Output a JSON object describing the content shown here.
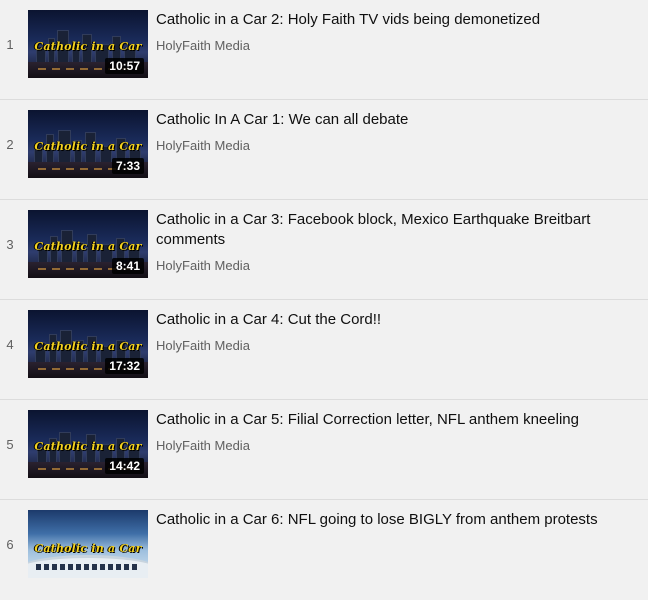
{
  "playlist": {
    "items": [
      {
        "index": "1",
        "title": "Catholic in a Car 2: Holy Faith TV vids being demonetized",
        "channel": "HolyFaith Media",
        "duration": "10:57",
        "thumb_text": "Catholic in a Car"
      },
      {
        "index": "2",
        "title": "Catholic In A Car 1: We can all debate",
        "channel": "HolyFaith Media",
        "duration": "7:33",
        "thumb_text": "Catholic in a Car"
      },
      {
        "index": "3",
        "title": "Catholic in a Car 3: Facebook block, Mexico Earthquake Breitbart comments",
        "channel": "HolyFaith Media",
        "duration": "8:41",
        "thumb_text": "Catholic in a Car"
      },
      {
        "index": "4",
        "title": "Catholic in a Car 4: Cut the Cord!!",
        "channel": "HolyFaith Media",
        "duration": "17:32",
        "thumb_text": "Catholic in a Car"
      },
      {
        "index": "5",
        "title": "Catholic in a Car 5: Filial Correction letter, NFL anthem kneeling",
        "channel": "HolyFaith Media",
        "duration": "14:42",
        "thumb_text": "Catholic in a Car"
      },
      {
        "index": "6",
        "title": "Catholic in a Car 6: NFL going to lose BIGLY from anthem protests",
        "channel": "",
        "duration": "",
        "thumb_text": "Catholic in a Car"
      }
    ]
  },
  "colors": {
    "background": "#f1f1f1",
    "title_text": "#0f0f0f",
    "secondary_text": "#606060",
    "thumb_title": "#f4d21f"
  }
}
